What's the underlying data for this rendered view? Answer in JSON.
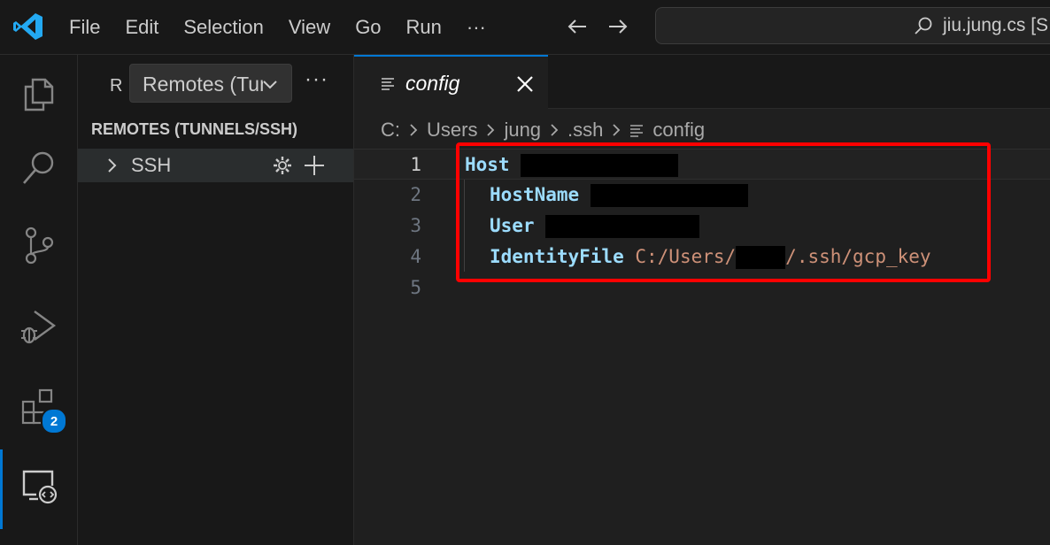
{
  "titlebar": {
    "menu": [
      "File",
      "Edit",
      "Selection",
      "View",
      "Go",
      "Run",
      "···"
    ],
    "search_text": "jiu.jung.cs [S"
  },
  "activity_bar": {
    "items": [
      "explorer-icon",
      "search-icon",
      "source-control-icon",
      "run-debug-icon",
      "extensions-icon",
      "remote-explorer-icon"
    ],
    "extensions_badge": "2"
  },
  "sidebar": {
    "title_abbrev": "R",
    "view_select": "Remotes (Tunnels/SSH)",
    "more": "···",
    "section_heading": "REMOTES (TUNNELS/SSH)",
    "tree": [
      {
        "label": "SSH"
      }
    ]
  },
  "editor": {
    "tab": {
      "label": "config"
    },
    "breadcrumb": [
      "C:",
      "Users",
      "jung",
      ".ssh",
      "config"
    ],
    "lines": [
      {
        "num": "1",
        "keyword": "Host",
        "value": ""
      },
      {
        "num": "2",
        "keyword": "HostName",
        "value": ""
      },
      {
        "num": "3",
        "keyword": "User",
        "value": ""
      },
      {
        "num": "4",
        "keyword": "IdentityFile",
        "value_prefix": "C:/Users/",
        "value_suffix": "/.ssh/gcp_key"
      },
      {
        "num": "5",
        "keyword": "",
        "value": ""
      }
    ]
  },
  "colors": {
    "accent": "#0078d4",
    "keyword": "#9cdcfe",
    "string": "#ce9178",
    "annotation": "#ff0000"
  }
}
